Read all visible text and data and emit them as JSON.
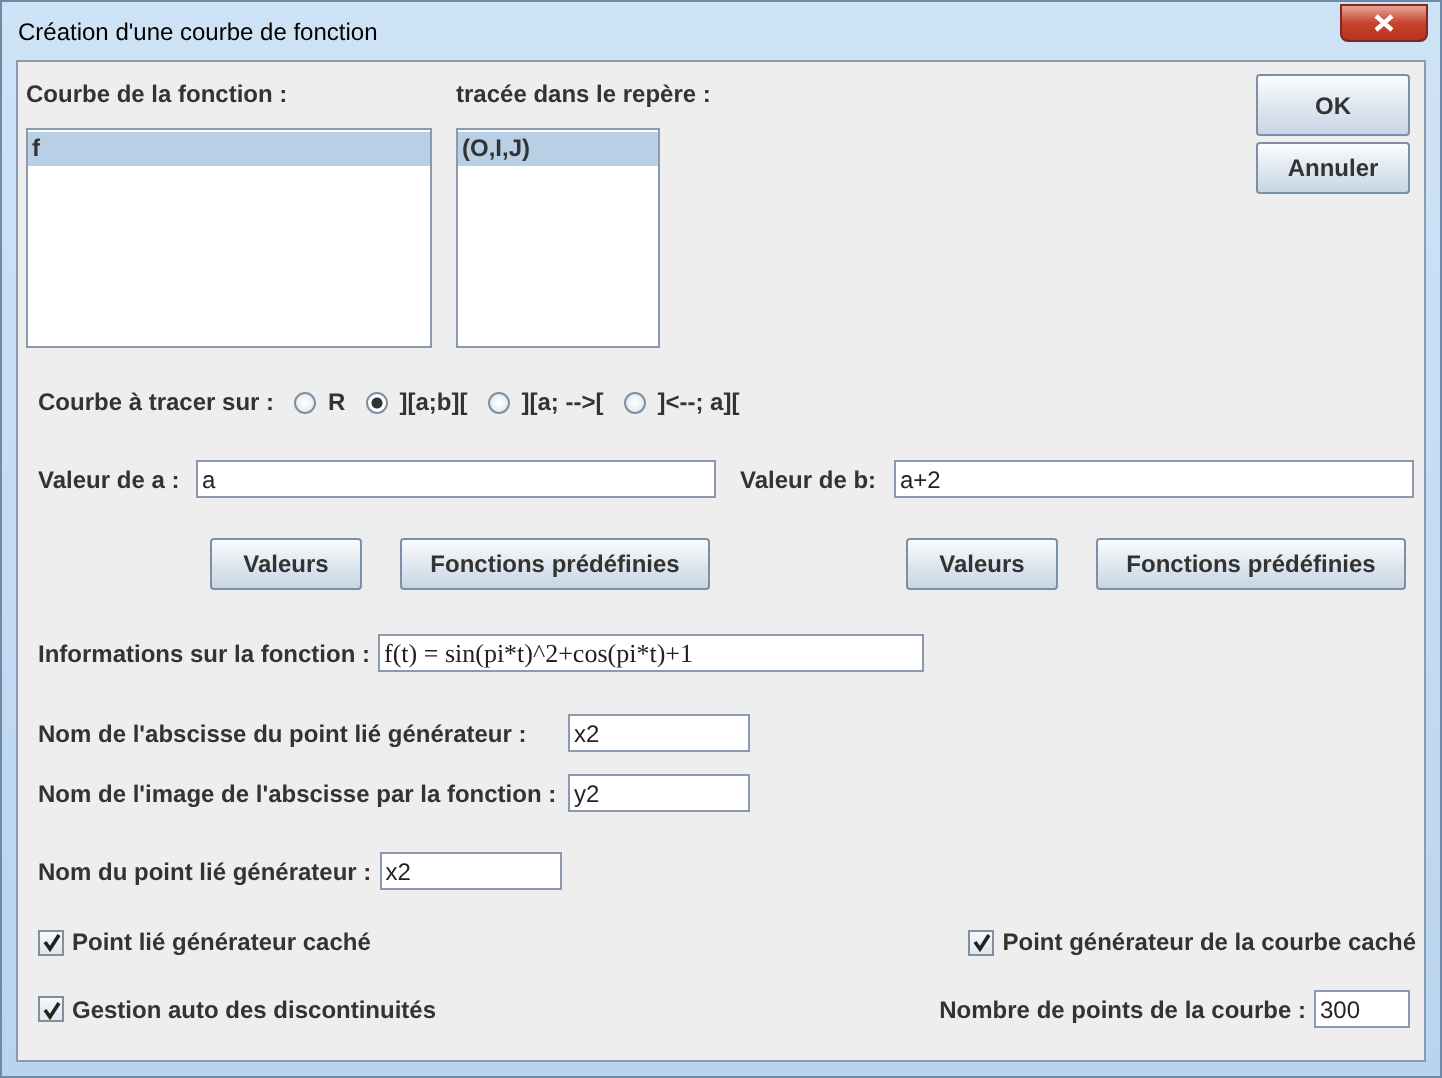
{
  "window": {
    "title": "Création d'une courbe de fonction"
  },
  "lists": [
    {
      "label": "Courbe de la fonction :",
      "items": [
        {
          "text": "f",
          "selected": true
        }
      ]
    },
    {
      "label": "tracée dans le repère :",
      "items": [
        {
          "text": "(O,I,J)",
          "selected": true
        }
      ]
    }
  ],
  "buttons": [
    "OK",
    "Annuler"
  ],
  "domain": {
    "label": "Courbe à tracer sur :",
    "options": [
      {
        "label": "R",
        "selected": false
      },
      {
        "label": "][a;b][",
        "selected": true
      },
      {
        "label": "][a; -->[",
        "selected": false
      },
      {
        "label": "]<--; a][",
        "selected": false
      }
    ]
  },
  "bounds": [
    {
      "label": "Valeur de a :",
      "value": "a",
      "buttons": [
        "Valeurs",
        "Fonctions prédéfinies"
      ]
    },
    {
      "label": "Valeur de b:",
      "value": "a+2",
      "buttons": [
        "Valeurs",
        "Fonctions prédéfinies"
      ]
    }
  ],
  "info": {
    "label": "Informations sur la fonction :",
    "value": "f(t) = sin(pi*t)^2+cos(pi*t)+1"
  },
  "name_fields": [
    {
      "label": "Nom de l'abscisse du point lié générateur :",
      "value": "x2"
    },
    {
      "label": "Nom de l'image de l'abscisse par la fonction :",
      "value": "y2"
    }
  ],
  "point_name": {
    "label": "Nom du point lié générateur :",
    "value": "x2"
  },
  "options": [
    {
      "label": "Point lié générateur caché",
      "checked": true
    },
    {
      "label": "Point générateur de la courbe caché",
      "checked": true
    },
    {
      "label": "Gestion auto des discontinuités",
      "checked": true
    }
  ],
  "point_count": {
    "label": "Nombre de points de la courbe :",
    "value": "300"
  }
}
